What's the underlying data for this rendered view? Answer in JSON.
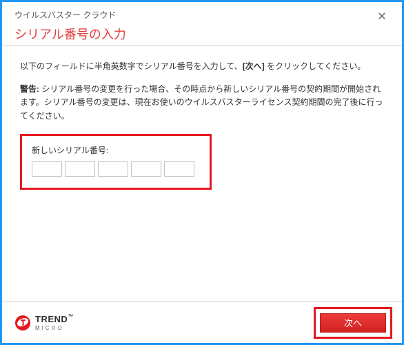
{
  "header": {
    "app_title": "ウイルスバスター クラウド",
    "page_title": "シリアル番号の入力"
  },
  "content": {
    "instruction_prefix": "以下のフィールドに半角英数字でシリアル番号を入力して、",
    "instruction_bold": "[次へ]",
    "instruction_suffix": " をクリックしてください。",
    "warning_label": "警告:",
    "warning_text": " シリアル番号の変更を行った場合、その時点から新しいシリアル番号の契約期間が開始されます。シリアル番号の変更は、現在お使いのウイルスバスターライセンス契約期間の完了後に行ってください。",
    "serial_label": "新しいシリアル番号:",
    "serial_segments": [
      "",
      "",
      "",
      "",
      ""
    ]
  },
  "footer": {
    "brand_trend": "TREND",
    "brand_micro": "MICRO",
    "brand_tm": "™",
    "next_label": "次へ"
  }
}
